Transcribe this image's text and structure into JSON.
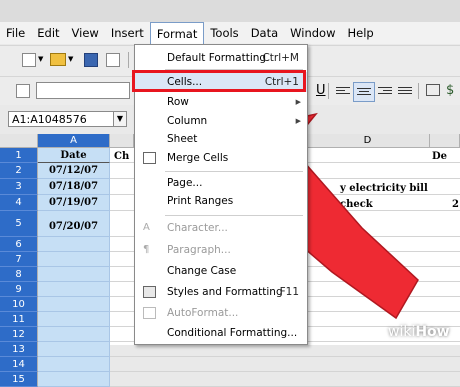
{
  "menubar": {
    "items": [
      "File",
      "Edit",
      "View",
      "Insert",
      "Format",
      "Tools",
      "Data",
      "Window",
      "Help"
    ]
  },
  "namebox": {
    "value": "A1:A1048576"
  },
  "columns": [
    "A",
    "D",
    "De"
  ],
  "rows": [
    {
      "num": "1",
      "a": "Date"
    },
    {
      "num": "2",
      "a": "07/12/07"
    },
    {
      "num": "3",
      "a": "07/18/07"
    },
    {
      "num": "4",
      "a": "07/19/07"
    },
    {
      "num": "5",
      "a": "07/20/07"
    },
    {
      "num": "6",
      "a": ""
    },
    {
      "num": "7",
      "a": ""
    },
    {
      "num": "8",
      "a": ""
    },
    {
      "num": "9",
      "a": ""
    },
    {
      "num": "10",
      "a": ""
    },
    {
      "num": "11",
      "a": ""
    },
    {
      "num": "12",
      "a": ""
    },
    {
      "num": "13",
      "a": ""
    },
    {
      "num": "14",
      "a": ""
    },
    {
      "num": "15",
      "a": ""
    }
  ],
  "sheet_text": {
    "b1_partial": "Ch",
    "d3_partial": "y electricity bill",
    "d4_partial": "check",
    "e4_partial": "2"
  },
  "format_menu": {
    "default_formatting": "Default Formatting",
    "default_formatting_shortcut": "Ctrl+M",
    "cells": "Cells...",
    "cells_shortcut": "Ctrl+1",
    "row": "Row",
    "column": "Column",
    "sheet": "Sheet",
    "merge_cells": "Merge Cells",
    "page": "Page...",
    "print_ranges": "Print Ranges",
    "character": "Character...",
    "paragraph": "Paragraph...",
    "change_case": "Change Case",
    "styles_and_formatting": "Styles and Formatting",
    "styles_shortcut": "F11",
    "autoformat": "AutoFormat...",
    "conditional_formatting": "Conditional Formatting..."
  },
  "watermark": {
    "wiki": "wiki",
    "how": "How"
  },
  "colors": {
    "highlight_red": "#e8151f",
    "arrow_red": "#ee2a33",
    "selection_blue": "#2e6cc8",
    "column_fill": "#c6dff5"
  }
}
